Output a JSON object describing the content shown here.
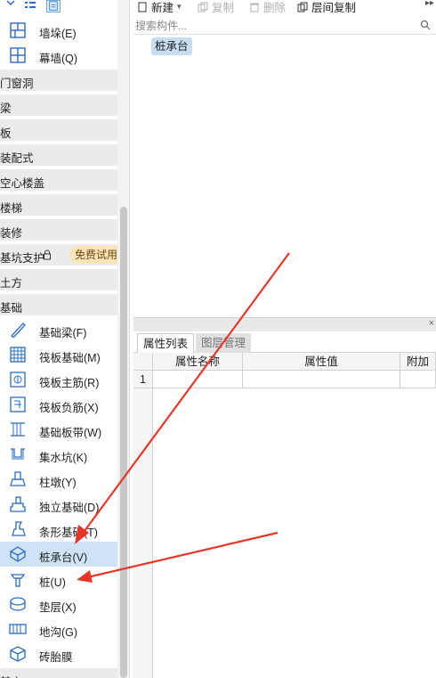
{
  "left_panel": {
    "top_items": [
      {
        "label": "墙垛(E)",
        "icon": "wall-pier-icon"
      },
      {
        "label": "幕墙(Q)",
        "icon": "curtain-wall-icon"
      }
    ],
    "categories": [
      {
        "label": "门窗洞"
      },
      {
        "label": "梁"
      },
      {
        "label": "板"
      },
      {
        "label": "装配式"
      },
      {
        "label": "空心楼盖"
      },
      {
        "label": "楼梯"
      },
      {
        "label": "装修"
      },
      {
        "label": "基坑支护",
        "badge": "免费试用"
      },
      {
        "label": "土方"
      },
      {
        "label": "基础"
      }
    ],
    "foundation_items": [
      {
        "label": "基础梁(F)",
        "icon": "foundation-beam-icon"
      },
      {
        "label": "筏板基础(M)",
        "icon": "raft-foundation-icon"
      },
      {
        "label": "筏板主筋(R)",
        "icon": "raft-main-rebar-icon"
      },
      {
        "label": "筏板负筋(X)",
        "icon": "raft-negative-rebar-icon"
      },
      {
        "label": "基础板带(W)",
        "icon": "foundation-strip-icon"
      },
      {
        "label": "集水坑(K)",
        "icon": "sump-pit-icon"
      },
      {
        "label": "柱墩(Y)",
        "icon": "column-pier-icon"
      },
      {
        "label": "独立基础(D)",
        "icon": "isolated-foundation-icon"
      },
      {
        "label": "条形基础(T)",
        "icon": "strip-foundation-icon"
      },
      {
        "label": "桩承台(V)",
        "icon": "pile-cap-icon",
        "selected": true
      },
      {
        "label": "桩(U)",
        "icon": "pile-icon"
      },
      {
        "label": "垫层(X)",
        "icon": "cushion-layer-icon"
      },
      {
        "label": "地沟(G)",
        "icon": "trench-icon"
      },
      {
        "label": "砖胎膜",
        "icon": "brick-form-icon"
      }
    ],
    "bottom_category": {
      "label": "其它"
    }
  },
  "toolbar": {
    "new_label": "新建",
    "copy_label": "复制",
    "delete_label": "删除",
    "floor_copy_label": "层间复制"
  },
  "search": {
    "placeholder": "搜索构件..."
  },
  "component_list": {
    "items": [
      "桩承台"
    ]
  },
  "property_panel": {
    "tabs": [
      "属性列表",
      "图层管理"
    ],
    "columns": [
      "属性名称",
      "属性值",
      "附加"
    ],
    "rows": [
      {
        "index": "1",
        "name": "",
        "value": "",
        "extra": ""
      }
    ]
  },
  "colors": {
    "arrow": "#e8352a",
    "selected_row": "#cfe3f7",
    "badge": "#fde3b8"
  }
}
